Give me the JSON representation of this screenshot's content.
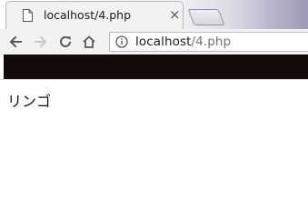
{
  "tab": {
    "title": "localhost/4.php",
    "close_glyph": "×",
    "icon": "document-icon"
  },
  "toolbar": {
    "back_icon": "arrow-left-icon",
    "forward_icon": "arrow-right-icon",
    "reload_icon": "reload-icon",
    "home_icon": "home-icon",
    "info_icon": "info-icon"
  },
  "address_bar": {
    "host": "localhost",
    "path": "/4.php"
  },
  "page": {
    "text": "リンゴ"
  }
}
